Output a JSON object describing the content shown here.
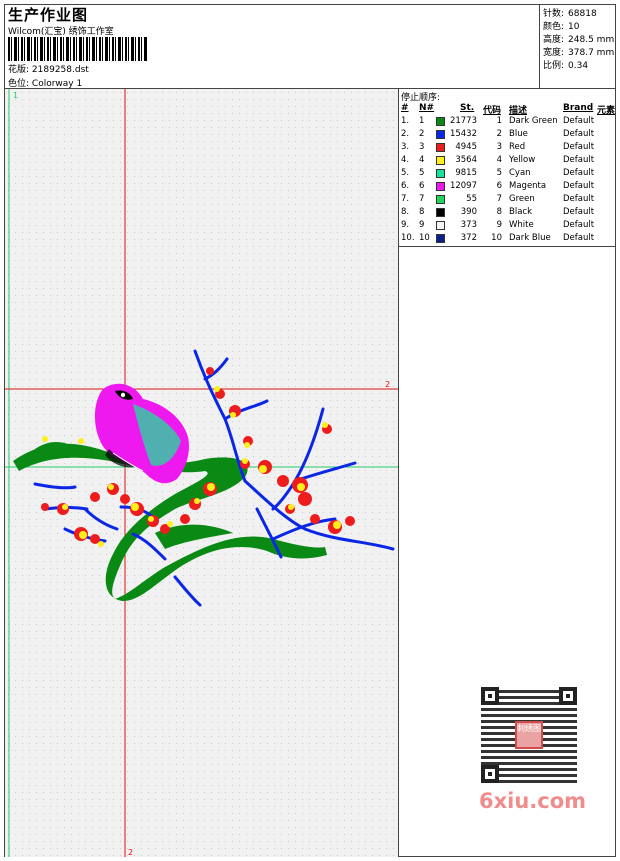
{
  "header": {
    "title": "生产作业图",
    "studio": "Wilcom(汇宝) 绣饰工作室",
    "design_label": "花版:",
    "design_file": "2189258.dst",
    "colorway_label": "色位:",
    "colorway": "Colorway 1"
  },
  "stats": [
    {
      "label": "针数:",
      "value": "68818"
    },
    {
      "label": "颜色:",
      "value": "10"
    },
    {
      "label": "高度:",
      "value": "248.5 mm"
    },
    {
      "label": "宽度:",
      "value": "378.7 mm"
    },
    {
      "label": "比例:",
      "value": "0.34"
    }
  ],
  "canvas": {
    "marker_top": "1",
    "marker_right": "2",
    "marker_bottom": "2"
  },
  "colors": {
    "dark_green": "#0a8a14",
    "blue": "#0a26e6",
    "red": "#ee1c1c",
    "yellow": "#ffef1a",
    "cyan": "#19e39a",
    "magenta": "#ee19ee",
    "black": "#000000",
    "guide_red": "#e01010",
    "guide_green": "#22cc66"
  },
  "sequence": {
    "title": "停止顺序:",
    "headers": {
      "num": "#",
      "no": "N#",
      "st": "St.",
      "code": "代码",
      "desc": "描述",
      "brand": "Brand",
      "element": "元素"
    },
    "rows": [
      {
        "num": "1.",
        "no": "1",
        "color": "#0a8a14",
        "st": "21773",
        "code": "1",
        "desc": "Dark Green",
        "brand": "Default"
      },
      {
        "num": "2.",
        "no": "2",
        "color": "#0a26e6",
        "st": "15432",
        "code": "2",
        "desc": "Blue",
        "brand": "Default"
      },
      {
        "num": "3.",
        "no": "3",
        "color": "#ee1c1c",
        "st": "4945",
        "code": "3",
        "desc": "Red",
        "brand": "Default"
      },
      {
        "num": "4.",
        "no": "4",
        "color": "#ffef1a",
        "st": "3564",
        "code": "4",
        "desc": "Yellow",
        "brand": "Default"
      },
      {
        "num": "5.",
        "no": "5",
        "color": "#19e39a",
        "st": "9815",
        "code": "5",
        "desc": "Cyan",
        "brand": "Default"
      },
      {
        "num": "6.",
        "no": "6",
        "color": "#ee19ee",
        "st": "12097",
        "code": "6",
        "desc": "Magenta",
        "brand": "Default"
      },
      {
        "num": "7.",
        "no": "7",
        "color": "#1ed65a",
        "st": "55",
        "code": "7",
        "desc": "Green",
        "brand": "Default"
      },
      {
        "num": "8.",
        "no": "8",
        "color": "#000000",
        "st": "390",
        "code": "8",
        "desc": "Black",
        "brand": "Default"
      },
      {
        "num": "9.",
        "no": "9",
        "color": "#f4f4f4",
        "st": "373",
        "code": "9",
        "desc": "White",
        "brand": "Default"
      },
      {
        "num": "10.",
        "no": "10",
        "color": "#0a1e8c",
        "st": "372",
        "code": "10",
        "desc": "Dark Blue",
        "brand": "Default"
      }
    ]
  },
  "watermark": {
    "site": "6xiu.com",
    "seal_text": "刺绣图"
  }
}
